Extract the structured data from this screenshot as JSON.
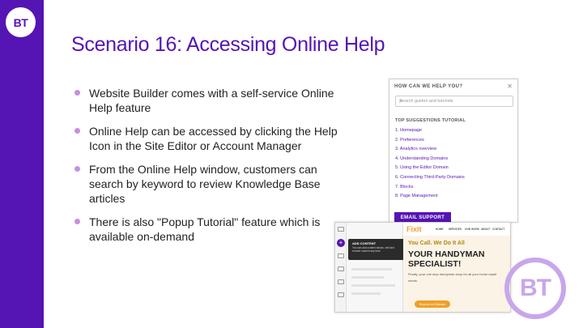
{
  "brand": {
    "logo_text": "BT",
    "accent": "#5514b4",
    "bullet_color": "#c390e6"
  },
  "slide": {
    "title": "Scenario 16: Accessing Online Help",
    "bullets": [
      "Website Builder comes with a self-service Online Help feature",
      "Online Help can be accessed by clicking the Help Icon in the Site Editor or Account Manager",
      "From the Online Help window, customers can search by keyword to review Knowledge Base articles",
      "There is also \"Popup Tutorial\" feature which is available on-demand"
    ]
  },
  "help_panel": {
    "heading": "HOW CAN WE HELP YOU?",
    "close_icon": "close-icon",
    "search_placeholder": "Search guides and tutorials",
    "search_icon": "search-icon",
    "suggestions_heading": "TOP SUGGESTIONS     TUTORIAL",
    "suggestions": [
      "1. Homepage",
      "2. Preferences",
      "3. Analytics overview",
      "4. Understanding Domains",
      "5. Using the Editor Domain",
      "6. Connecting Third-Party Domains",
      "7. Blocks",
      "8. Page Management"
    ],
    "email_button": "EMAIL SUPPORT"
  },
  "site_editor": {
    "tooltip_title": "ADD CONTENT",
    "tooltip_text": "You can add content blocks, edit and reorder content any time.",
    "site_logo": "Fixit",
    "nav": [
      "HOME",
      "SERVICES",
      "OUR WORK",
      "ABOUT",
      "CONTACT"
    ],
    "tagline": "You Call. We Do It All",
    "headline": "YOUR HANDYMAN SPECIALIST!",
    "body": "Finally, your one stop handyman shop for all your home repair needs.",
    "cta": "Request an Estimate"
  },
  "watermark": {
    "text": "BT"
  }
}
